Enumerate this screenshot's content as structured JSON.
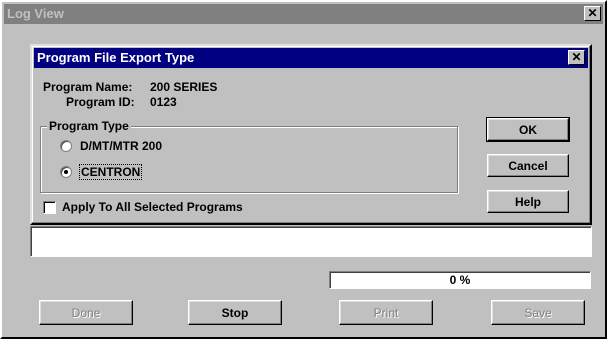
{
  "window": {
    "title": "Log View",
    "close_glyph": "✕"
  },
  "dialog": {
    "title": "Program File Export Type",
    "close_glyph": "✕",
    "program_name_label": "Program Name:",
    "program_name_value": "200 SERIES",
    "program_id_label": "Program ID:",
    "program_id_value": "0123",
    "program_type_title": "Program Type",
    "options": [
      {
        "label": "D/MT/MTR 200",
        "selected": false
      },
      {
        "label": "CENTRON",
        "selected": true
      }
    ],
    "apply_all_label": "Apply To All Selected Programs",
    "apply_all_checked": false,
    "ok_label": "OK",
    "cancel_label": "Cancel",
    "help_label": "Help"
  },
  "log_field_value": "",
  "progress": {
    "text": "0 %",
    "fraction": 0
  },
  "buttons": {
    "done": "Done",
    "stop": "Stop",
    "print": "Print",
    "save": "Save"
  },
  "colors": {
    "dialog_title_bg": "#000080",
    "inactive_title_bg": "#808080",
    "face": "#c0c0c0"
  }
}
